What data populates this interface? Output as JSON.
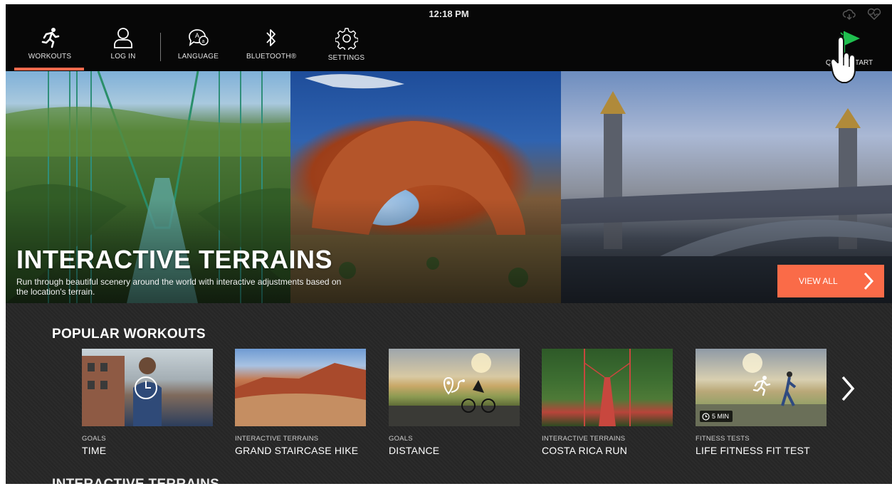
{
  "status_bar": {
    "time": "12:18 PM",
    "icons": [
      "cloud-sync-icon",
      "heart-rate-icon"
    ]
  },
  "nav": {
    "items": [
      {
        "label": "WORKOUTS",
        "icon": "running-person-icon",
        "active": true
      },
      {
        "label": "LOG IN",
        "icon": "user-icon"
      },
      {
        "label": "LANGUAGE",
        "icon": "language-bubble-icon"
      },
      {
        "label": "BLUETOOTH®",
        "icon": "bluetooth-icon"
      },
      {
        "label": "SETTINGS",
        "icon": "gear-icon"
      }
    ],
    "quick_start": {
      "label": "QUICK START",
      "icon": "flag-icon",
      "accent": "#1fbf4f"
    }
  },
  "hero": {
    "title": "INTERACTIVE TERRAINS",
    "description": "Run through beautiful scenery around the world with interactive adjustments based on the location's terrain.",
    "button": "VIEW ALL",
    "button_color": "#fa6b48"
  },
  "popular": {
    "title": "POPULAR WORKOUTS",
    "cards": [
      {
        "category": "GOALS",
        "title": "TIME",
        "icon": "clock-icon"
      },
      {
        "category": "INTERACTIVE TERRAINS",
        "title": "GRAND STAIRCASE HIKE"
      },
      {
        "category": "GOALS",
        "title": "DISTANCE",
        "icon": "route-pin-icon"
      },
      {
        "category": "INTERACTIVE TERRAINS",
        "title": "COSTA RICA RUN"
      },
      {
        "category": "FITNESS TESTS",
        "title": "LIFE FITNESS FIT TEST",
        "icon": "running-person-icon",
        "duration": "5 MIN"
      }
    ]
  },
  "next_section": {
    "title": "INTERACTIVE TERRAINS"
  },
  "accent_color": "#ff6a4d"
}
